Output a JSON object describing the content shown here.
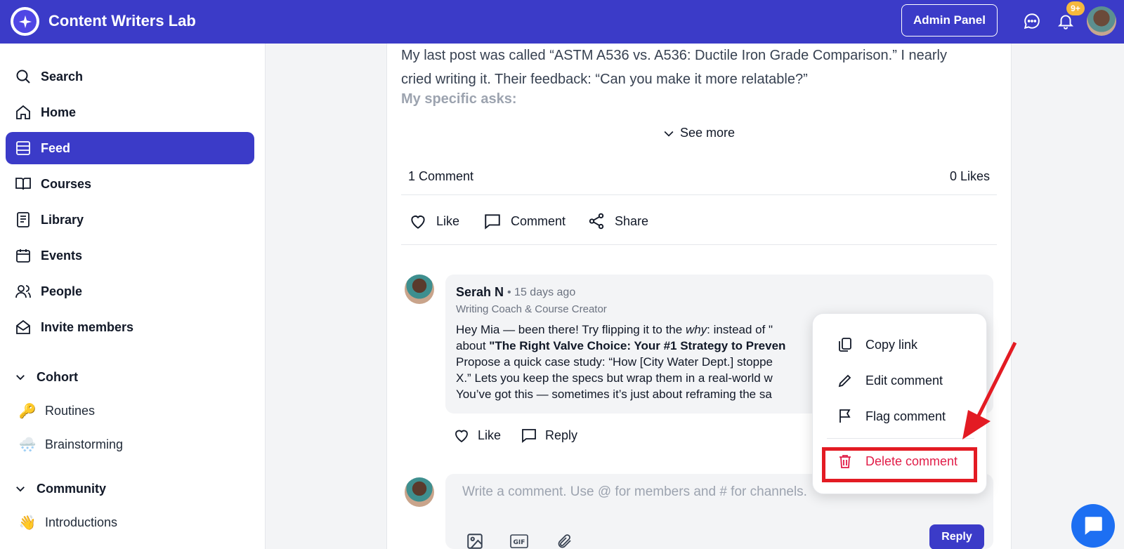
{
  "app": {
    "title": "Content Writers Lab"
  },
  "topbar": {
    "admin_label": "Admin Panel",
    "notif_badge": "9+"
  },
  "sidebar": {
    "items": [
      {
        "label": "Search",
        "icon": "search-icon"
      },
      {
        "label": "Home",
        "icon": "home-icon"
      },
      {
        "label": "Feed",
        "icon": "feed-icon",
        "active": true
      },
      {
        "label": "Courses",
        "icon": "book-icon"
      },
      {
        "label": "Library",
        "icon": "library-icon"
      },
      {
        "label": "Events",
        "icon": "calendar-icon"
      },
      {
        "label": "People",
        "icon": "people-icon"
      },
      {
        "label": "Invite members",
        "icon": "mail-icon"
      }
    ],
    "groups": [
      {
        "label": "Cohort",
        "channels": [
          {
            "emoji": "🔑",
            "label": "Routines"
          },
          {
            "emoji": "🌨️",
            "label": "Brainstorming"
          }
        ]
      },
      {
        "label": "Community",
        "channels": [
          {
            "emoji": "👋",
            "label": "Introductions"
          }
        ]
      }
    ]
  },
  "post": {
    "line1": "My last post was called “ASTM A536 vs. A536: Ductile Iron Grade Comparison.” I nearly",
    "line2": "cried writing it. Their feedback: “Can you make it more relatable?”",
    "faded": "My specific asks:",
    "see_more": "See more",
    "comments_count": "1 Comment",
    "likes_count": "0 Likes",
    "actions": {
      "like": "Like",
      "comment": "Comment",
      "share": "Share"
    }
  },
  "comment": {
    "author": "Serah N",
    "time": "• 15 days ago",
    "role": "Writing Coach & Course Creator",
    "line1_a": "Hey Mia — been there! Try flipping it to the ",
    "line1_em": "why",
    "line1_b": ": instead of \"",
    "line2_a": "about ",
    "line2_strong": "\"The Right Valve Choice: Your #1 Strategy to Preven",
    "line3": "Propose a quick case study: “How [City Water Dept.] stoppe",
    "line4": "X.” Lets you keep the specs but wrap them in a real-world w",
    "line5": "You’ve got this — sometimes it’s just about reframing the sa",
    "like": "Like",
    "reply": "Reply"
  },
  "reply_box": {
    "placeholder": "Write a comment. Use @ for members and # for channels.",
    "button": "Reply"
  },
  "menu": {
    "copy_link": "Copy link",
    "edit": "Edit comment",
    "flag": "Flag comment",
    "delete": "Delete comment"
  },
  "colors": {
    "brand": "#3b3bc8",
    "danger": "#e11d48",
    "annotation": "#e31b23",
    "chat": "#1d6ff2"
  }
}
